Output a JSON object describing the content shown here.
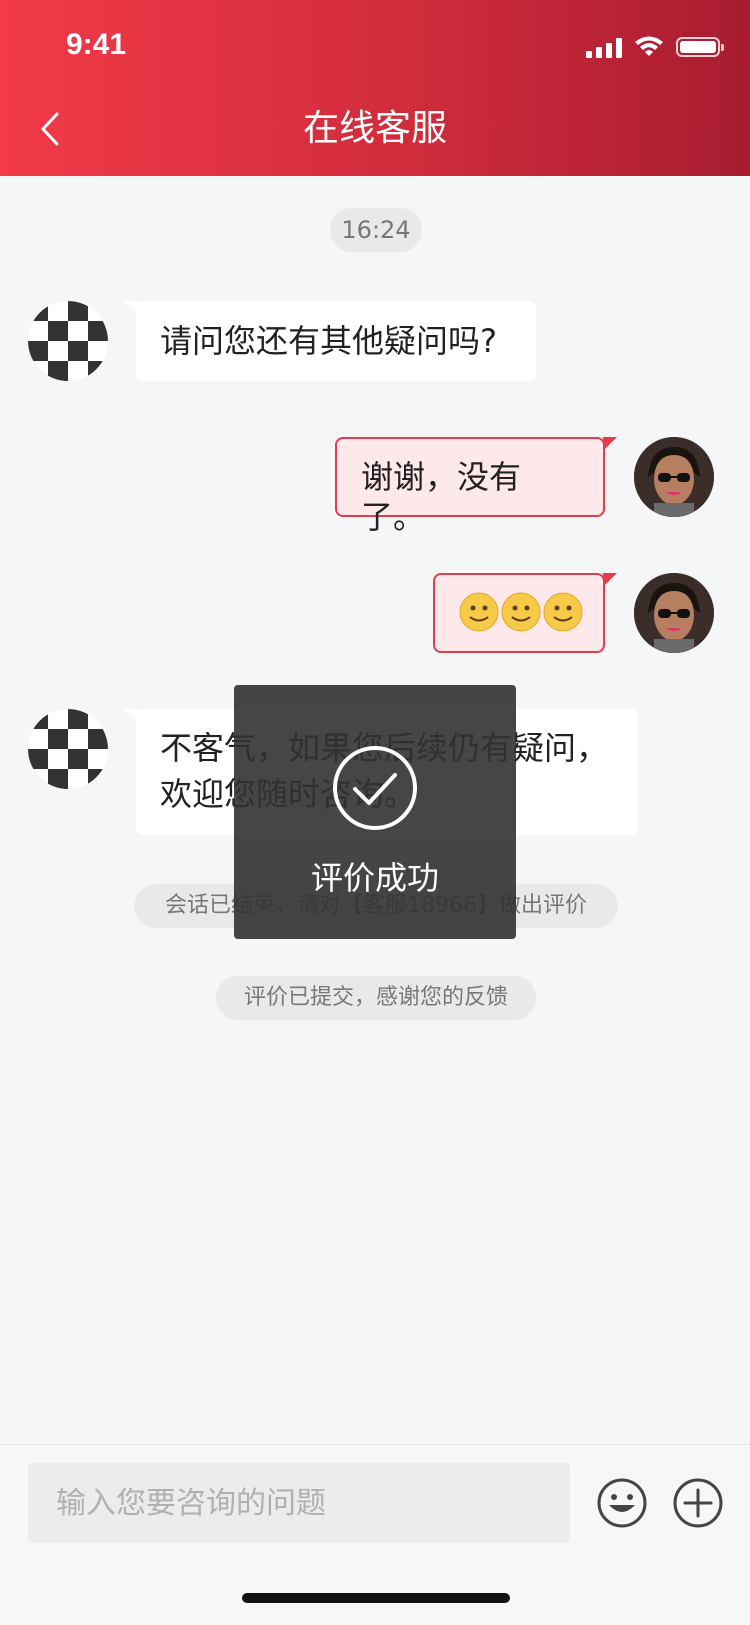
{
  "status_bar": {
    "time": "9:41"
  },
  "header": {
    "title": "在线客服"
  },
  "chat": {
    "timestamp": "16:24",
    "messages": [
      {
        "side": "left",
        "text": "请问您还有其他疑问吗?"
      },
      {
        "side": "right",
        "text": "谢谢，没有了。"
      },
      {
        "side": "right",
        "text": "🙂🙂🙂"
      },
      {
        "side": "left",
        "line1": "不客气，如果您后续仍有疑问，",
        "line2": "欢迎您随时咨询。"
      }
    ],
    "system_ended": "会话已结束，请对【客服18966】做出评价",
    "system_submitted": "评价已提交，感谢您的反馈"
  },
  "toast": {
    "text": "评价成功"
  },
  "input_bar": {
    "placeholder": "输入您要咨询的问题"
  },
  "colors": {
    "brand_red": "#e23d4c",
    "header_dark": "#a81c30"
  }
}
